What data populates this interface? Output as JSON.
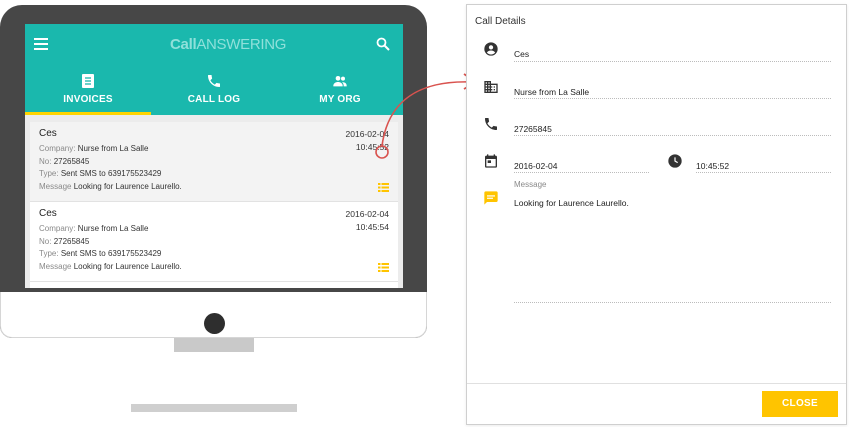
{
  "app": {
    "logo_bold": "Call",
    "logo_rest": "ANSWERING"
  },
  "tabs": [
    {
      "label": "INVOICES",
      "icon": "invoice-icon",
      "active": true
    },
    {
      "label": "CALL LOG",
      "icon": "phone-icon",
      "active": false
    },
    {
      "label": "MY ORG",
      "icon": "group-icon",
      "active": false
    }
  ],
  "calls": [
    {
      "name": "Ces",
      "company_key": "Company:",
      "company": "Nurse from La Salle",
      "no_key": "No:",
      "no": "27265845",
      "type_key": "Type:",
      "type": "Sent SMS to 639175523429",
      "message_key": "Message",
      "message": "Looking for Laurence Laurello.",
      "date": "2016-02-04",
      "time": "10:45:52"
    },
    {
      "name": "Ces",
      "company_key": "Company:",
      "company": "Nurse from La Salle",
      "no_key": "No:",
      "no": "27265845",
      "type_key": "Type:",
      "type": "Sent SMS to 639175523429",
      "message_key": "Message",
      "message": "Looking for Laurence Laurello.",
      "date": "2016-02-04",
      "time": "10:45:54"
    }
  ],
  "dialog": {
    "title": "Call Details",
    "name": "Ces",
    "company": "Nurse from La Salle",
    "phone": "27265845",
    "date": "2016-02-04",
    "time": "10:45:52",
    "message_label": "Message",
    "message": "Looking for Laurence Laurello.",
    "close_label": "CLOSE"
  },
  "colors": {
    "teal": "#1ab8ad",
    "accent_yellow": "#ffc400",
    "arrow_red": "#d9534f"
  }
}
